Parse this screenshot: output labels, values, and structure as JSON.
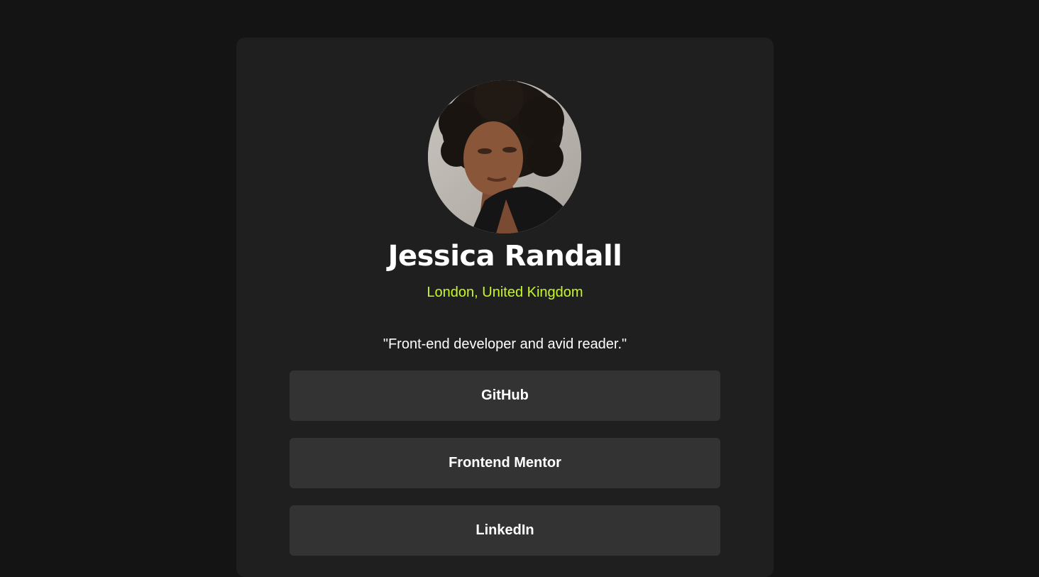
{
  "profile": {
    "name": "Jessica Randall",
    "location": "London, United Kingdom",
    "bio": "\"Front-end developer and avid reader.\"",
    "avatar_icon": "profile-photo"
  },
  "links": [
    {
      "label": "GitHub"
    },
    {
      "label": "Frontend Mentor"
    },
    {
      "label": "LinkedIn"
    }
  ],
  "colors": {
    "page_background": "#141414",
    "card_background": "#1f1f1f",
    "button_background": "#333333",
    "accent": "#c4f82a",
    "text": "#ffffff"
  }
}
